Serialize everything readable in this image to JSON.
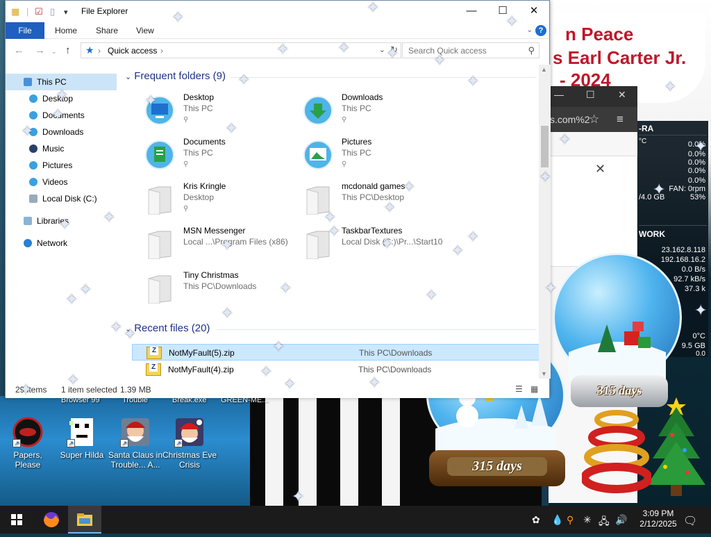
{
  "explorer": {
    "title": "File Explorer",
    "window_controls": {
      "minimize": "—",
      "maximize": "☐",
      "close": "✕"
    },
    "ribbon": {
      "file": "File",
      "home": "Home",
      "share": "Share",
      "view": "View",
      "help": "?"
    },
    "address": {
      "crumb": "Quick access",
      "chev": "›"
    },
    "search": {
      "placeholder": "Search Quick access"
    },
    "nav": [
      {
        "label": "This PC"
      },
      {
        "label": "Desktop"
      },
      {
        "label": "Documents"
      },
      {
        "label": "Downloads"
      },
      {
        "label": "Music"
      },
      {
        "label": "Pictures"
      },
      {
        "label": "Videos"
      },
      {
        "label": "Local Disk (C:)"
      },
      {
        "label": "Libraries"
      },
      {
        "label": "Network"
      }
    ],
    "frequent_header": "Frequent folders (9)",
    "frequent": [
      {
        "name": "Desktop",
        "location": "This PC"
      },
      {
        "name": "Downloads",
        "location": "This PC"
      },
      {
        "name": "Documents",
        "location": "This PC"
      },
      {
        "name": "Pictures",
        "location": "This PC"
      },
      {
        "name": "Kris Kringle",
        "location": "Desktop"
      },
      {
        "name": "mcdonald games",
        "location": "This PC\\Desktop"
      },
      {
        "name": "MSN Messenger",
        "location": "Local ...\\Program Files (x86)"
      },
      {
        "name": "TaskbarTextures",
        "location": "Local Disk (C:)\\Pr...\\Start10"
      },
      {
        "name": "Tiny Christmas",
        "location": "This PC\\Downloads"
      }
    ],
    "recent_header": "Recent files (20)",
    "recent": [
      {
        "name": "NotMyFault(5).zip",
        "path": "This PC\\Downloads"
      },
      {
        "name": "NotMyFault(4).zip",
        "path": "This PC\\Downloads"
      }
    ],
    "status": {
      "items": "29 items",
      "selected": "1 item selected",
      "size": "1.39 MB"
    }
  },
  "desktop_icons": [
    {
      "label": "Papers, Please"
    },
    {
      "label": "Super Hilda"
    },
    {
      "label": "Santa Claus in Trouble... A..."
    },
    {
      "label": "Christmas Eve Crisis"
    }
  ],
  "desktop_top_labels": [
    "Browser 99",
    "Trouble",
    "Break.exe",
    "GREEN-ME..."
  ],
  "banner": {
    "line1": "n Peace",
    "line2": "s Earl Carter Jr.",
    "line3": "- 2024"
  },
  "browser": {
    "url_fragment": "s.com%2",
    "minimize": "—",
    "maximize": "☐",
    "close": "✕",
    "star": "☆",
    "menu": "≡",
    "dialog_close": "✕"
  },
  "sysmon": {
    "ram_header": "-RA",
    "cpu_unit": "°C",
    "pct_values": [
      "0.0%",
      "0.0%",
      "0.0%",
      "0.0%",
      "0.0%"
    ],
    "fan": "FAN: 0rpm",
    "mem": "/4.0 GB",
    "mem_pct": "53%",
    "network_header": "WORK",
    "ip1": "23.162.8.118",
    "ip2": "192.168.16.2",
    "rate1": "0.0 B/s",
    "rate2": "92.7 kB/s",
    "rate3": "37.3 k",
    "temp": "0°C",
    "disk": "9.5 GB",
    "disk2": "0.0"
  },
  "globes": {
    "small_label": "315 days",
    "large_label": "315 days"
  },
  "taskbar": {
    "time": "3:09 PM",
    "date": "2/12/2025"
  }
}
